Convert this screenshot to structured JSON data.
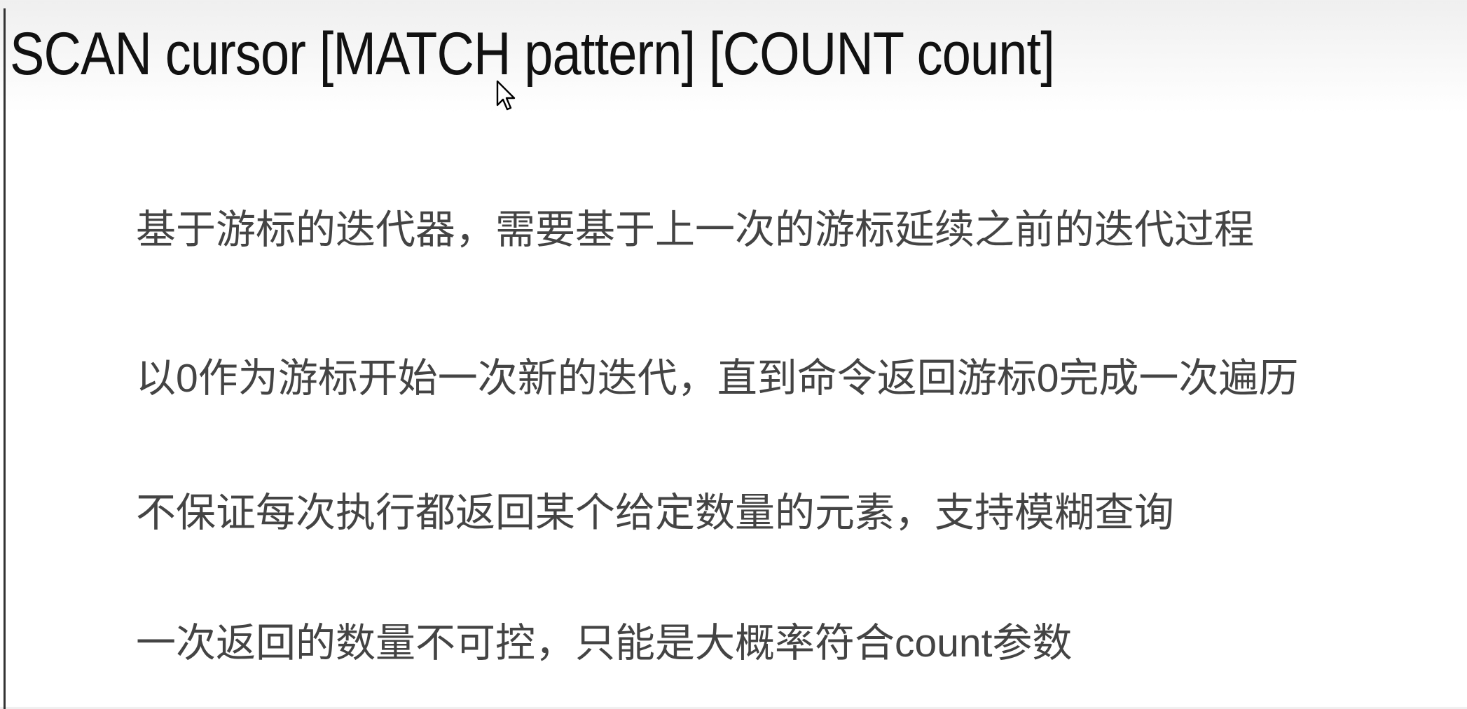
{
  "slide": {
    "title": "SCAN cursor [MATCH pattern] [COUNT count]",
    "bullets": [
      "基于游标的迭代器，需要基于上一次的游标延续之前的迭代过程",
      "以0作为游标开始一次新的迭代，直到命令返回游标0完成一次遍历",
      "不保证每次执行都返回某个给定数量的元素，支持模糊查询",
      "一次返回的数量不可控，只能是大概率符合count参数"
    ]
  }
}
